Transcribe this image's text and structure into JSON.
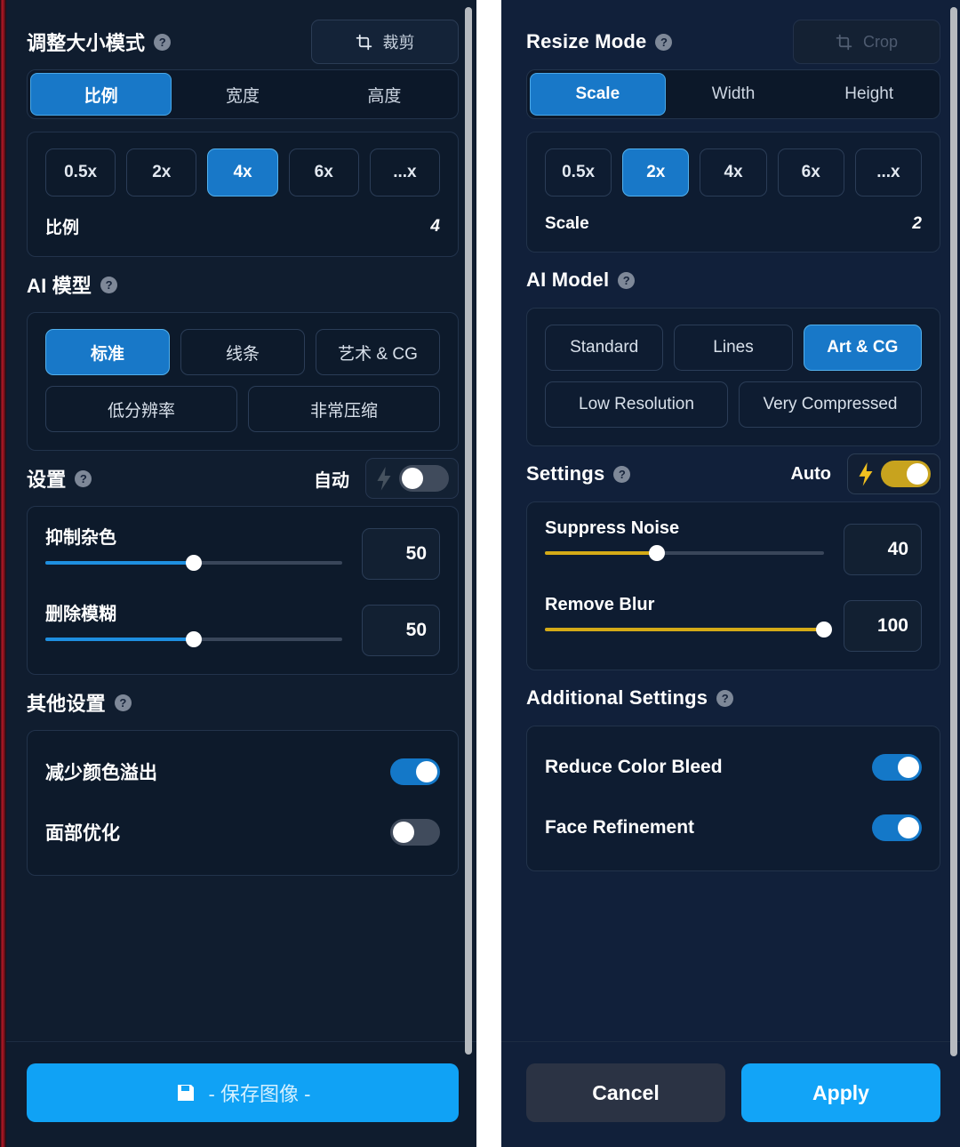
{
  "left_panel": {
    "lang": "zh",
    "resize_mode": {
      "title": "调整大小模式",
      "help": "?",
      "crop_button": "裁剪",
      "crop_icon": "crop-icon",
      "tabs": [
        {
          "label": "比例",
          "active": true
        },
        {
          "label": "宽度",
          "active": false
        },
        {
          "label": "高度",
          "active": false
        }
      ],
      "scale_chips": [
        {
          "label": "0.5x",
          "active": false
        },
        {
          "label": "2x",
          "active": false
        },
        {
          "label": "4x",
          "active": true
        },
        {
          "label": "6x",
          "active": false
        },
        {
          "label": "...x",
          "active": false
        }
      ],
      "value_key": "比例",
      "value": "4"
    },
    "ai_model": {
      "title": "AI 模型",
      "help": "?",
      "row1": [
        {
          "label": "标准",
          "active": true
        },
        {
          "label": "线条",
          "active": false
        },
        {
          "label": "艺术 & CG",
          "active": false
        }
      ],
      "row2": [
        {
          "label": "低分辨率",
          "active": false
        },
        {
          "label": "非常压缩",
          "active": false
        }
      ]
    },
    "settings": {
      "title": "设置",
      "help": "?",
      "auto_label": "自动",
      "auto_on": false,
      "bolt_icon": "bolt-icon",
      "sliders": [
        {
          "label": "抑制杂色",
          "value": "50",
          "percent": 50,
          "accent": "blue"
        },
        {
          "label": "删除模糊",
          "value": "50",
          "percent": 50,
          "accent": "blue"
        }
      ]
    },
    "additional": {
      "title": "其他设置",
      "help": "?",
      "toggles": [
        {
          "label": "减少颜色溢出",
          "on": true
        },
        {
          "label": "面部优化",
          "on": false
        }
      ]
    },
    "footer": {
      "save_label": "- 保存图像 -",
      "save_icon": "save-icon"
    }
  },
  "right_panel": {
    "lang": "en",
    "resize_mode": {
      "title": "Resize Mode",
      "help": "?",
      "crop_button": "Crop",
      "crop_icon": "crop-icon",
      "crop_disabled": true,
      "tabs": [
        {
          "label": "Scale",
          "active": true
        },
        {
          "label": "Width",
          "active": false
        },
        {
          "label": "Height",
          "active": false
        }
      ],
      "scale_chips": [
        {
          "label": "0.5x",
          "active": false
        },
        {
          "label": "2x",
          "active": true
        },
        {
          "label": "4x",
          "active": false
        },
        {
          "label": "6x",
          "active": false
        },
        {
          "label": "...x",
          "active": false
        }
      ],
      "value_key": "Scale",
      "value": "2"
    },
    "ai_model": {
      "title": "AI Model",
      "help": "?",
      "row1": [
        {
          "label": "Standard",
          "active": false
        },
        {
          "label": "Lines",
          "active": false
        },
        {
          "label": "Art & CG",
          "active": true
        }
      ],
      "row2": [
        {
          "label": "Low Resolution",
          "active": false
        },
        {
          "label": "Very Compressed",
          "active": false
        }
      ]
    },
    "settings": {
      "title": "Settings",
      "help": "?",
      "auto_label": "Auto",
      "auto_on": true,
      "bolt_icon": "bolt-icon",
      "sliders": [
        {
          "label": "Suppress Noise",
          "value": "40",
          "percent": 40,
          "accent": "gold"
        },
        {
          "label": "Remove Blur",
          "value": "100",
          "percent": 100,
          "accent": "gold"
        }
      ]
    },
    "additional": {
      "title": "Additional Settings",
      "help": "?",
      "toggles": [
        {
          "label": "Reduce Color Bleed",
          "on": true
        },
        {
          "label": "Face Refinement",
          "on": true
        }
      ]
    },
    "footer": {
      "cancel_label": "Cancel",
      "apply_label": "Apply"
    }
  },
  "colors": {
    "accent_blue": "#1878c8",
    "accent_bright_blue": "#12a4f7",
    "accent_gold": "#c8a31e",
    "panel_bg": "#0f1c2e",
    "card_bg": "#0d1a2b",
    "text_primary": "#ffffff",
    "text_muted": "#cdd6e2",
    "edge_stripe_red": "#b01725"
  }
}
